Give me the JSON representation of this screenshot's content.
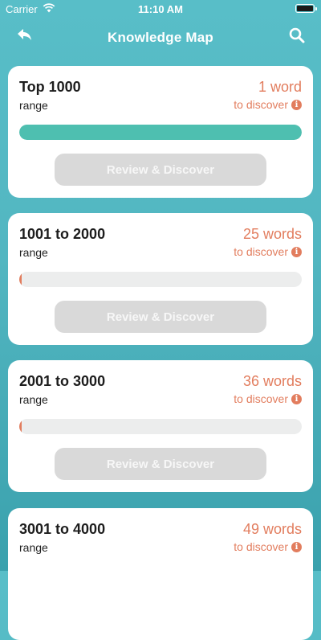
{
  "status_bar": {
    "carrier": "Carrier",
    "time": "11:10 AM"
  },
  "nav": {
    "title": "Knowledge Map"
  },
  "cards": [
    {
      "title": "Top 1000",
      "subtitle": "range",
      "count": "1 word",
      "discover": "to discover",
      "progress": 1.0,
      "button": "Review & Discover"
    },
    {
      "title": "1001 to 2000",
      "subtitle": "range",
      "count": "25 words",
      "discover": "to discover",
      "progress": 0.0,
      "button": "Review & Discover"
    },
    {
      "title": "2001 to 3000",
      "subtitle": "range",
      "count": "36 words",
      "discover": "to discover",
      "progress": 0.0,
      "button": "Review & Discover"
    },
    {
      "title": "3001 to 4000",
      "subtitle": "range",
      "count": "49 words",
      "discover": "to discover"
    }
  ],
  "colors": {
    "accent": "#e27d5e",
    "progress": "#4ebfb0",
    "button_disabled": "#d9d9d9"
  },
  "icons": {
    "back": "back-arrow-icon",
    "search": "search-icon",
    "info": "info-icon"
  }
}
